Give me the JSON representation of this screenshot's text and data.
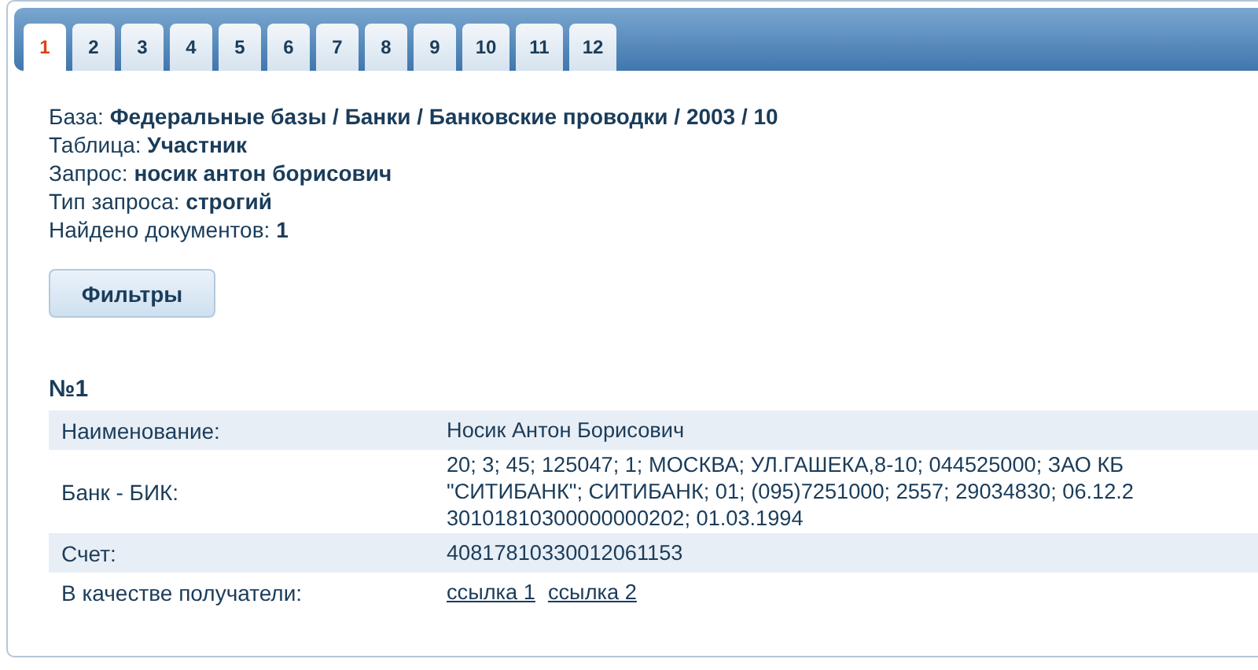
{
  "tabs": [
    {
      "label": "1",
      "selected": true
    },
    {
      "label": "2",
      "selected": false
    },
    {
      "label": "3",
      "selected": false
    },
    {
      "label": "4",
      "selected": false
    },
    {
      "label": "5",
      "selected": false
    },
    {
      "label": "6",
      "selected": false
    },
    {
      "label": "7",
      "selected": false
    },
    {
      "label": "8",
      "selected": false
    },
    {
      "label": "9",
      "selected": false
    },
    {
      "label": "10",
      "selected": false
    },
    {
      "label": "11",
      "selected": false
    },
    {
      "label": "12",
      "selected": false
    }
  ],
  "info": [
    {
      "label": "База:",
      "value": "Федеральные базы / Банки / Банковские проводки / 2003 / 10"
    },
    {
      "label": "Таблица:",
      "value": "Участник"
    },
    {
      "label": "Запрос:",
      "value": "носик антон борисович"
    },
    {
      "label": "Тип запроса:",
      "value": "строгий"
    },
    {
      "label": "Найдено документов:",
      "value": "1"
    }
  ],
  "filter_button": "Фильтры",
  "record": {
    "title": "№1",
    "rows": [
      {
        "kind": "text",
        "label": "Наименование:",
        "lines": [
          "Носик Антон Борисович"
        ]
      },
      {
        "kind": "text",
        "label": "Банк - БИК:",
        "lines": [
          "20; 3; 45; 125047; 1; МОСКВА; УЛ.ГАШЕКА,8-10; 044525000; ЗАО КБ",
          "\"СИТИБАНК\"; СИТИБАНК; 01; (095)7251000; 2557; 29034830; 06.12.2",
          "30101810300000000202; 01.03.1994"
        ]
      },
      {
        "kind": "text",
        "label": "Счет:",
        "lines": [
          "40817810330012061153"
        ]
      },
      {
        "kind": "links",
        "label": "В качестве получатели:",
        "links": [
          "ссылка 1",
          "ссылка 2"
        ]
      }
    ]
  }
}
